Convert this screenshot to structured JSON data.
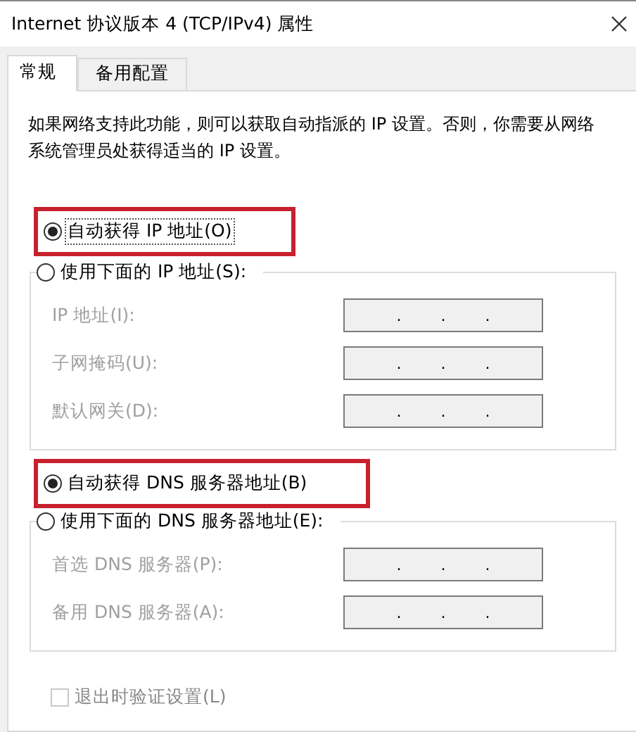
{
  "window": {
    "title": "Internet 协议版本 4 (TCP/IPv4) 属性"
  },
  "tabs": [
    {
      "label": "常规",
      "selected": true
    },
    {
      "label": "备用配置",
      "selected": false
    }
  ],
  "description": "如果网络支持此功能，则可以获取自动指派的 IP 设置。否则，你需要从网络系统管理员处获得适当的 IP 设置。",
  "sections": [
    {
      "auto": {
        "label": "自动获得 IP 地址(O)",
        "selected": true,
        "highlighted": true,
        "focused": true
      },
      "manual": {
        "label": "使用下面的 IP 地址(S):",
        "selected": false
      },
      "fields": [
        {
          "label": "IP 地址(I):",
          "dots": [
            ".",
            ".",
            "."
          ],
          "disabled": true
        },
        {
          "label": "子网掩码(U):",
          "dots": [
            ".",
            ".",
            "."
          ],
          "disabled": true
        },
        {
          "label": "默认网关(D):",
          "dots": [
            ".",
            ".",
            "."
          ],
          "disabled": true
        }
      ]
    },
    {
      "auto": {
        "label": "自动获得 DNS 服务器地址(B)",
        "selected": true,
        "highlighted": true,
        "focused": false
      },
      "manual": {
        "label": "使用下面的 DNS 服务器地址(E):",
        "selected": false
      },
      "fields": [
        {
          "label": "首选 DNS 服务器(P):",
          "dots": [
            ".",
            ".",
            "."
          ],
          "disabled": true
        },
        {
          "label": "备用 DNS 服务器(A):",
          "dots": [
            ".",
            ".",
            "."
          ],
          "disabled": true
        }
      ]
    }
  ],
  "validate_on_exit": {
    "label": "退出时验证设置(L)",
    "checked": false,
    "disabled": true
  }
}
